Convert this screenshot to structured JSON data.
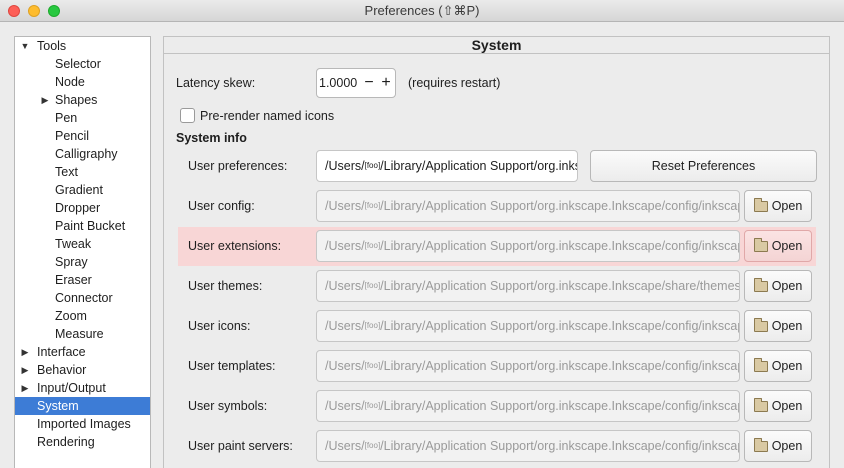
{
  "window": {
    "title": "Preferences (⇧⌘P)"
  },
  "sidebar": {
    "items": [
      {
        "label": "Tools",
        "expander": "down",
        "indent": 0
      },
      {
        "label": "Selector",
        "indent": 2
      },
      {
        "label": "Node",
        "indent": 2
      },
      {
        "label": "Shapes",
        "expander": "right",
        "indent": 2
      },
      {
        "label": "Pen",
        "indent": 2
      },
      {
        "label": "Pencil",
        "indent": 2
      },
      {
        "label": "Calligraphy",
        "indent": 2
      },
      {
        "label": "Text",
        "indent": 2
      },
      {
        "label": "Gradient",
        "indent": 2
      },
      {
        "label": "Dropper",
        "indent": 2
      },
      {
        "label": "Paint Bucket",
        "indent": 2
      },
      {
        "label": "Tweak",
        "indent": 2
      },
      {
        "label": "Spray",
        "indent": 2
      },
      {
        "label": "Eraser",
        "indent": 2
      },
      {
        "label": "Connector",
        "indent": 2
      },
      {
        "label": "Zoom",
        "indent": 2
      },
      {
        "label": "Measure",
        "indent": 2
      },
      {
        "label": "Interface",
        "expander": "right",
        "indent": 0
      },
      {
        "label": "Behavior",
        "expander": "right",
        "indent": 0
      },
      {
        "label": "Input/Output",
        "expander": "right",
        "indent": 0
      },
      {
        "label": "System",
        "selected": true,
        "indent": 0
      },
      {
        "label": "Imported Images",
        "indent": 0
      },
      {
        "label": "Rendering",
        "indent": 0
      }
    ]
  },
  "panel": {
    "title": "System",
    "latency": {
      "label": "Latency skew:",
      "value": "1.0000",
      "minus": "−",
      "plus": "+",
      "note": "(requires restart)"
    },
    "prerender": {
      "label": "Pre-render named icons",
      "checked": false
    },
    "section_title": "System info",
    "reset_label": "Reset Preferences",
    "open_label": "Open",
    "path_prefix": "/Users/",
    "foo_tag": "[foo]",
    "rows": [
      {
        "label": "User preferences:",
        "path": "/Library/Application Support/org.inkscape.Inkscape/config/inkscape/preferences.xml",
        "active": true
      },
      {
        "label": "User config:",
        "path": "/Library/Application Support/org.inkscape.Inkscape/config/inkscape"
      },
      {
        "label": "User extensions:",
        "path": "/Library/Application Support/org.inkscape.Inkscape/config/inkscape/extensions",
        "highlight": true
      },
      {
        "label": "User themes:",
        "path": "/Library/Application Support/org.inkscape.Inkscape/share/themes"
      },
      {
        "label": "User icons:",
        "path": "/Library/Application Support/org.inkscape.Inkscape/config/inkscape/icons"
      },
      {
        "label": "User templates:",
        "path": "/Library/Application Support/org.inkscape.Inkscape/config/inkscape/templates"
      },
      {
        "label": "User symbols:",
        "path": "/Library/Application Support/org.inkscape.Inkscape/config/inkscape/symbols"
      },
      {
        "label": "User paint servers:",
        "path": "/Library/Application Support/org.inkscape.Inkscape/config/inkscape/paint"
      }
    ]
  },
  "colors": {
    "selection": "#3d7cd6",
    "highlight_row": "#f8d6d6"
  }
}
